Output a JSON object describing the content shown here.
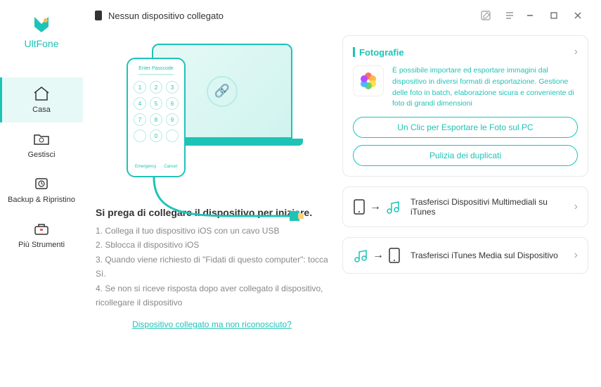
{
  "brand": "UltFone",
  "titlebar": {
    "status": "Nessun dispositivo collegato"
  },
  "sidebar": {
    "items": [
      {
        "label": "Casa"
      },
      {
        "label": "Gestisci"
      },
      {
        "label": "Backup & Ripristino"
      },
      {
        "label": "Più Strumenti"
      }
    ]
  },
  "connect": {
    "phone_header": "Enter Passcode",
    "phone_emergency": "Emergency",
    "phone_cancel": "Cancel",
    "title": "Si prega di collegare il dispositivo per iniziare.",
    "steps": [
      "1. Collega il tuo dispositivo iOS con un cavo USB",
      "2. Sblocca il dispositivo iOS",
      "3. Quando viene richiesto di \"Fidati di questo computer\": tocca Sì.",
      "4. Se non si riceve risposta dopo aver collegato il dispositivo, ricollegare il dispositivo"
    ],
    "help_link": "Dispositivo collegato ma non riconosciuto?"
  },
  "photos": {
    "title": "Fotografie",
    "desc": "È possibile importare ed esportare immagini dal dispositivo in diversi formati di esportazione. Gestione delle foto in batch, elaborazione sicura e conveniente di foto di grandi dimensioni",
    "export_btn": "Un Clic per Esportare le Foto sul PC",
    "dedup_btn": "Pulizia dei duplicati"
  },
  "transfer1": {
    "label": "Trasferisci Dispositivi Multimediali su iTunes"
  },
  "transfer2": {
    "label": "Trasferisci iTunes Media sul Dispositivo"
  }
}
